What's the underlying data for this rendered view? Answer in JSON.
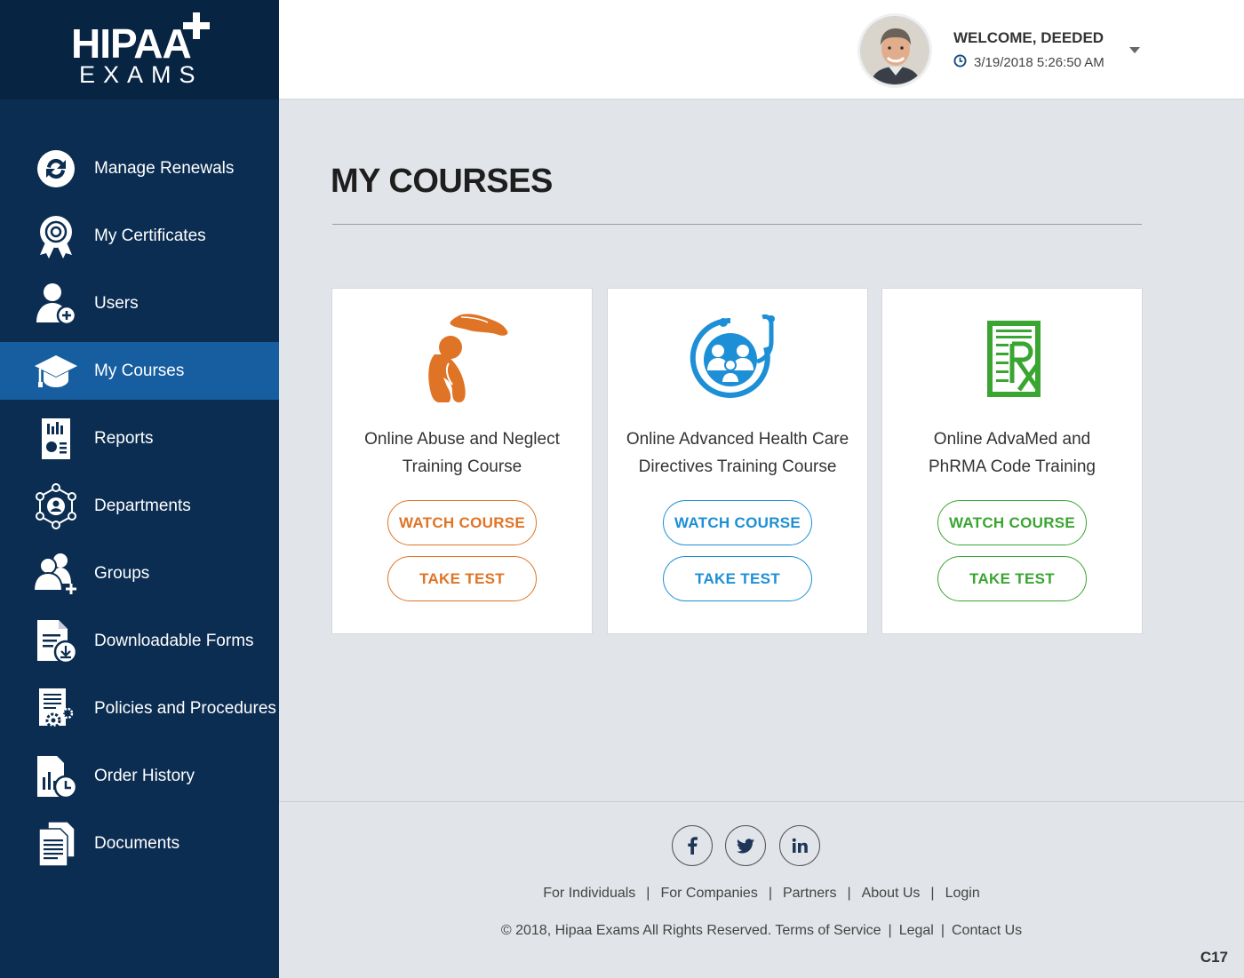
{
  "logo": {
    "line1": "HIPAA",
    "line2": "EXAMS"
  },
  "header": {
    "welcome": "WELCOME, DEEDED",
    "datetime": "3/19/2018 5:26:50 AM"
  },
  "sidebar": {
    "items": [
      {
        "label": "Manage Renewals",
        "icon": "renewal-icon"
      },
      {
        "label": "My Certificates",
        "icon": "certificate-icon"
      },
      {
        "label": "Users",
        "icon": "add-user-icon"
      },
      {
        "label": "My Courses",
        "icon": "graduation-cap-icon",
        "active": true
      },
      {
        "label": "Reports",
        "icon": "report-icon"
      },
      {
        "label": "Departments",
        "icon": "departments-icon"
      },
      {
        "label": "Groups",
        "icon": "add-group-icon"
      },
      {
        "label": "Downloadable Forms",
        "icon": "download-form-icon"
      },
      {
        "label": "Policies and Procedures",
        "icon": "policy-gear-icon"
      },
      {
        "label": "Order History",
        "icon": "order-history-icon"
      },
      {
        "label": "Documents",
        "icon": "documents-icon"
      }
    ]
  },
  "main": {
    "title": "MY COURSES",
    "courses": [
      {
        "title_line1": "Online Abuse and Neglect",
        "title_line2": "Training Course",
        "watch": "WATCH COURSE",
        "test": "TAKE TEST",
        "color": "#e07426",
        "icon": "abuse-neglect-icon"
      },
      {
        "title_line1": "Online Advanced Health Care",
        "title_line2": "Directives Training Course",
        "watch": "WATCH COURSE",
        "test": "TAKE TEST",
        "color": "#1c8fd6",
        "icon": "family-stethoscope-icon"
      },
      {
        "title_line1": "Online AdvaMed and",
        "title_line2": "PhRMA Code Training",
        "watch": "WATCH COURSE",
        "test": "TAKE TEST",
        "color": "#3aa531",
        "icon": "rx-prescription-icon"
      }
    ]
  },
  "footer": {
    "social": [
      "facebook-icon",
      "twitter-icon",
      "linkedin-icon"
    ],
    "links": [
      "For Individuals",
      "For Companies",
      "Partners",
      "About Us",
      "Login"
    ],
    "copyright": "© 2018, Hipaa Exams All Rights Reserved. Terms of Service",
    "legal": "Legal",
    "contact": "Contact Us",
    "code": "C17"
  }
}
